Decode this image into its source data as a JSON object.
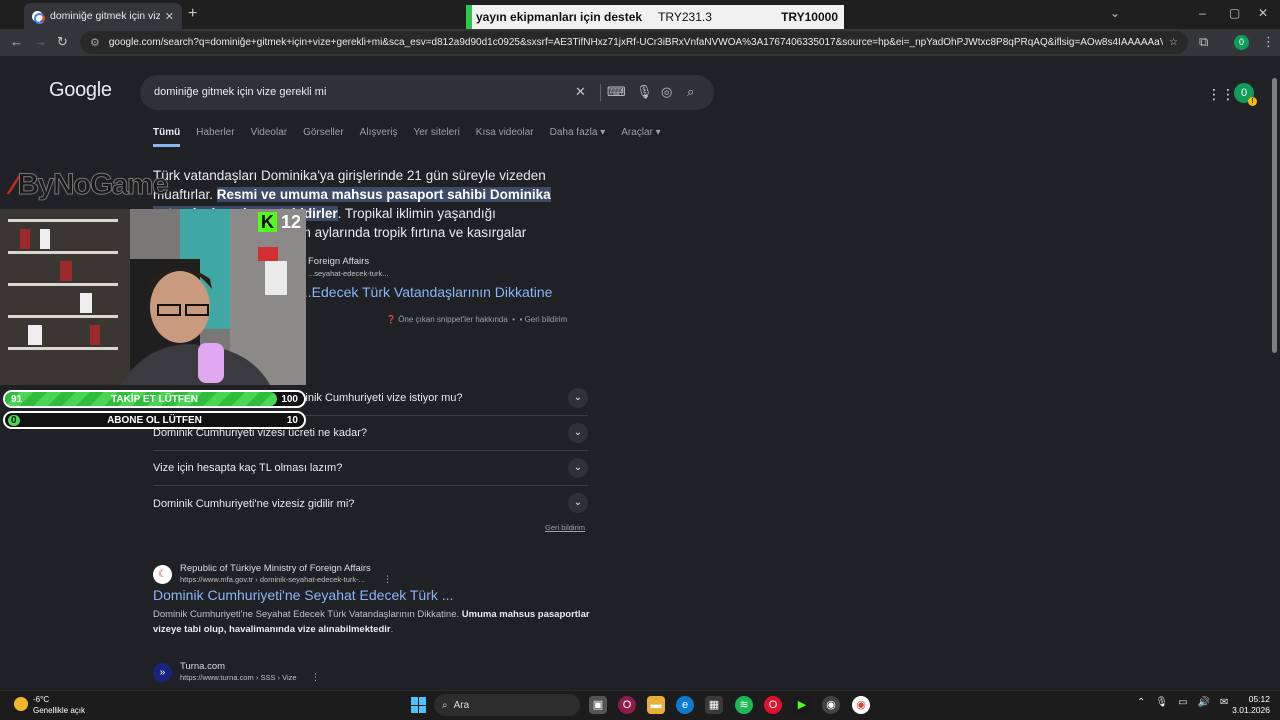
{
  "browser": {
    "tab_title": "dominiğe gitmek için vize gerekli mi",
    "tab_close": "✕",
    "new_tab": "+",
    "url": "google.com/search?q=dominiğe+gitmek+için+vize+gerekli+mi&sca_esv=d812a9d90d1c0925&sxsrf=AE3TifNHxz71jxRf-UCr3iBRxVnfaNVWOA%3A1767406335017&source=hp&ei=_npYadOhPJWtxc8P8qPRqAQ&iflsig=AOw8s4IAAAAAaViJDx_CmmmUZQt...",
    "profile_initial": "0",
    "win_min": "–",
    "win_max": "▢",
    "win_close": "✕"
  },
  "donation_bar": {
    "text": "yayın ekipmanları için destek",
    "current": "TRY231.3",
    "goal": "TRY10000"
  },
  "google": {
    "logo": "Google",
    "query": "dominiğe gitmek için vize gerekli mi",
    "avatar": "0",
    "tabs": [
      "Tümü",
      "Haberler",
      "Videolar",
      "Görseller",
      "Alışveriş",
      "Yer siteleri",
      "Kısa videolar",
      "Daha fazla ▾",
      "Araçlar ▾"
    ]
  },
  "featured_snippet": {
    "text_before": "Türk vatandaşları Dominika'ya girişlerinde 21 gün süreyle vizeden muaftırlar. ",
    "highlight": "Resmi ve umuma mahsus pasaport sahibi Dominika vatandaşları vizeye tabidirler",
    "text_after": ". Tropikal iklimin yaşandığı Dominika'da ağustos-ekim aylarında tropik fırtına ve kasırgalar görülebilmektedir.",
    "source_site": "Foreign Affairs",
    "source_url": "...seyahat-edecek-turk...",
    "result_title": "...Edecek Türk Vatandaşlarının Dikkatine",
    "about": "Öne çıkan snippet'ler hakkında",
    "feedback": "Geri bildirim"
  },
  "people_also_ask": [
    "...Dominik Cumhuriyeti vize istiyor mu?",
    "Dominik Cumhuriyeti vizesi ücreti ne kadar?",
    "Vize için hesapta kaç TL olması lazım?",
    "Dominik Cumhuriyeti'ne vizesiz gidilir mi?"
  ],
  "paa_feedback": "Geri bildirim",
  "results": [
    {
      "site": "Republic of Türkiye Ministry of Foreign Affairs",
      "url": "https://www.mfa.gov.tr › dominik-seyahat-edecek-turk-...",
      "title": "Dominik Cumhuriyeti'ne Seyahat Edecek Türk ...",
      "desc_plain": "Dominik Cumhuriyeti'ne Seyahat Edecek Türk Vatandaşlarının Dikkatine. ",
      "desc_bold": "Umuma mahsus pasaportlar vizeye tabi olup, havalimanında vize alınabilmektedir",
      "desc_end": "."
    },
    {
      "site": "Turna.com",
      "url": "https://www.turna.com › SSS › Vize"
    }
  ],
  "overlay": {
    "brand": "ByNoGame",
    "kick_viewers": "12",
    "follow_goal": {
      "label": "TAKİP ET LÜTFEN",
      "current": "91",
      "target": "100",
      "progress": 0.91
    },
    "sub_goal": {
      "label": "ABONE OL LÜTFEN",
      "current": "0",
      "target": "10",
      "progress": 0.0
    }
  },
  "taskbar": {
    "temp": "-6°C",
    "condition": "Genellikle açık",
    "search": "Ara",
    "time": "05:12",
    "date": "3.01.2026"
  }
}
